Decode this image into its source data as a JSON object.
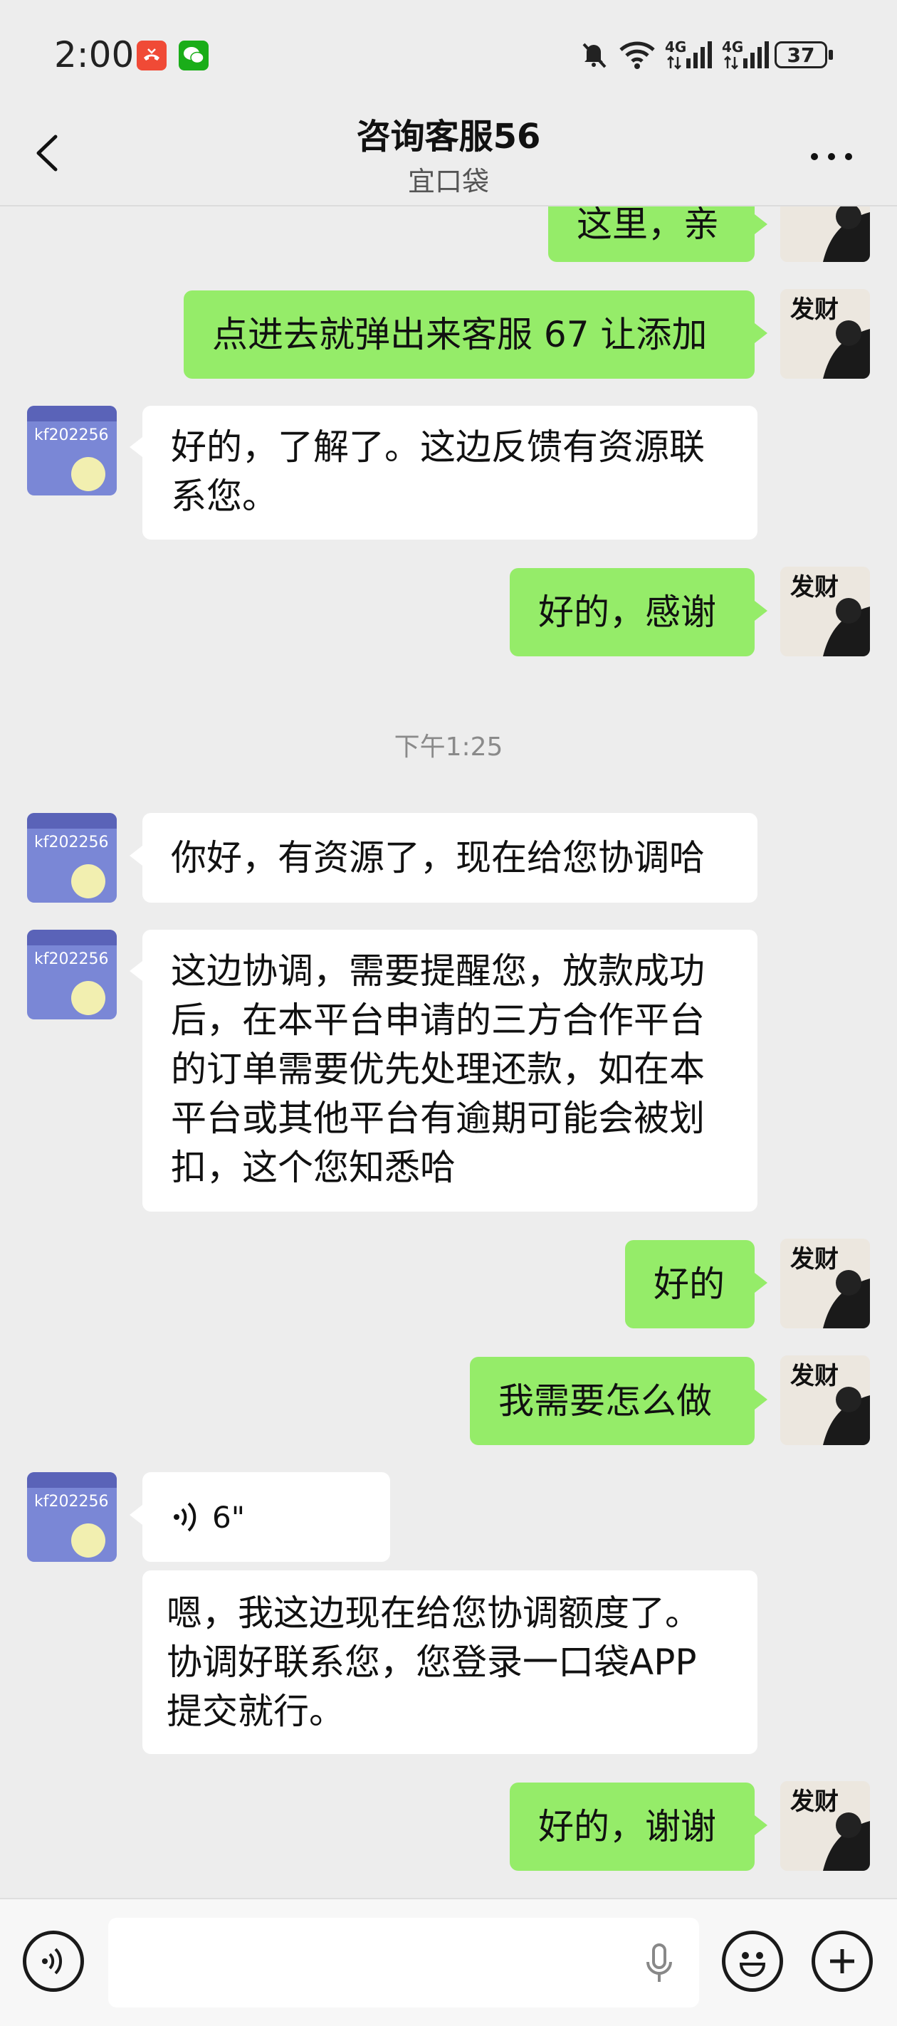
{
  "status_bar": {
    "time": "2:00",
    "network_1": "4G",
    "network_2": "4G",
    "battery": "37"
  },
  "header": {
    "title": "咨询客服56",
    "subtitle": "宜口袋",
    "back_icon": "back-arrow",
    "more_icon": "more-dots"
  },
  "avatars": {
    "agent_text": "kf202256",
    "me_text": "发财"
  },
  "messages": [
    {
      "side": "me",
      "text": "这里，亲"
    },
    {
      "side": "me",
      "text": "点进去就弹出来客服 67 让添加"
    },
    {
      "side": "agent",
      "lines": [
        "好的，了解了。这边反馈有资源联",
        "系您。"
      ]
    },
    {
      "side": "me",
      "text": "好的，感谢"
    },
    {
      "type": "timestamp",
      "text": "下午1:25"
    },
    {
      "side": "agent",
      "text": "你好，有资源了，现在给您协调哈"
    },
    {
      "side": "agent",
      "lines": [
        "这边协调，需要提醒您，放款成功",
        "后，在本平台申请的三方合作平台",
        "的订单需要优先处理还款，如在本",
        "平台或其他平台有逾期可能会被划",
        "扣，这个您知悉哈"
      ]
    },
    {
      "side": "me",
      "text": "好的"
    },
    {
      "side": "me",
      "text": "我需要怎么做"
    },
    {
      "side": "agent",
      "type": "voice",
      "duration": "6\""
    },
    {
      "side": "agent",
      "lines": [
        "嗯，我这边现在给您协调额度了。",
        "协调好联系您，您登录一口袋APP",
        "提交就行。"
      ]
    },
    {
      "side": "me",
      "text": "好的，谢谢"
    }
  ],
  "input_bar": {
    "voice_icon": "voice-mode",
    "mic_icon": "microphone",
    "emoji_icon": "emoji",
    "plus_icon": "plus"
  }
}
